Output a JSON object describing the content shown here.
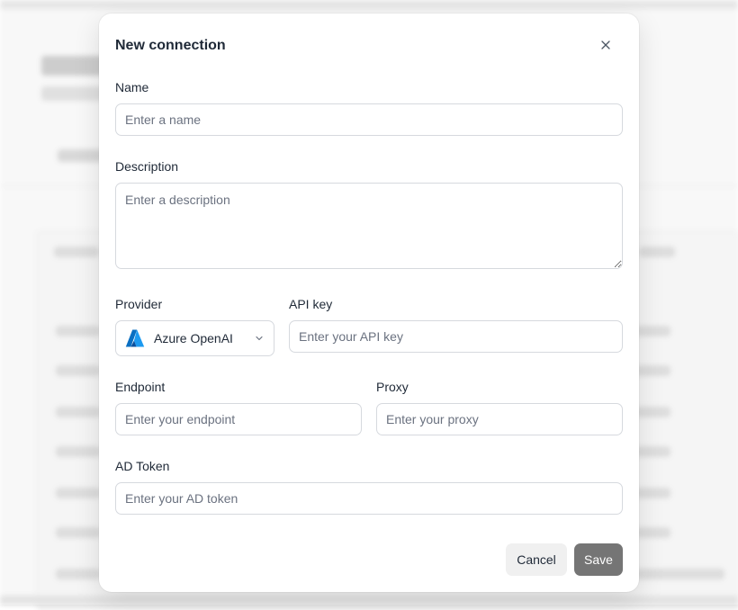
{
  "dialog": {
    "title": "New connection",
    "fields": {
      "name": {
        "label": "Name",
        "placeholder": "Enter a name",
        "value": ""
      },
      "description": {
        "label": "Description",
        "placeholder": "Enter a description",
        "value": ""
      },
      "provider": {
        "label": "Provider",
        "value": "Azure OpenAI",
        "icon": "azure-logo"
      },
      "api_key": {
        "label": "API key",
        "placeholder": "Enter your API key",
        "value": ""
      },
      "endpoint": {
        "label": "Endpoint",
        "placeholder": "Enter your endpoint",
        "value": ""
      },
      "proxy": {
        "label": "Proxy",
        "placeholder": "Enter your proxy",
        "value": ""
      },
      "ad_token": {
        "label": "AD Token",
        "placeholder": "Enter your AD token",
        "value": ""
      }
    },
    "buttons": {
      "cancel": "Cancel",
      "save": "Save"
    },
    "colors": {
      "save_bg": "#757575",
      "cancel_bg": "#f0f0f0",
      "azure_blue": "#0a7fd4"
    }
  }
}
